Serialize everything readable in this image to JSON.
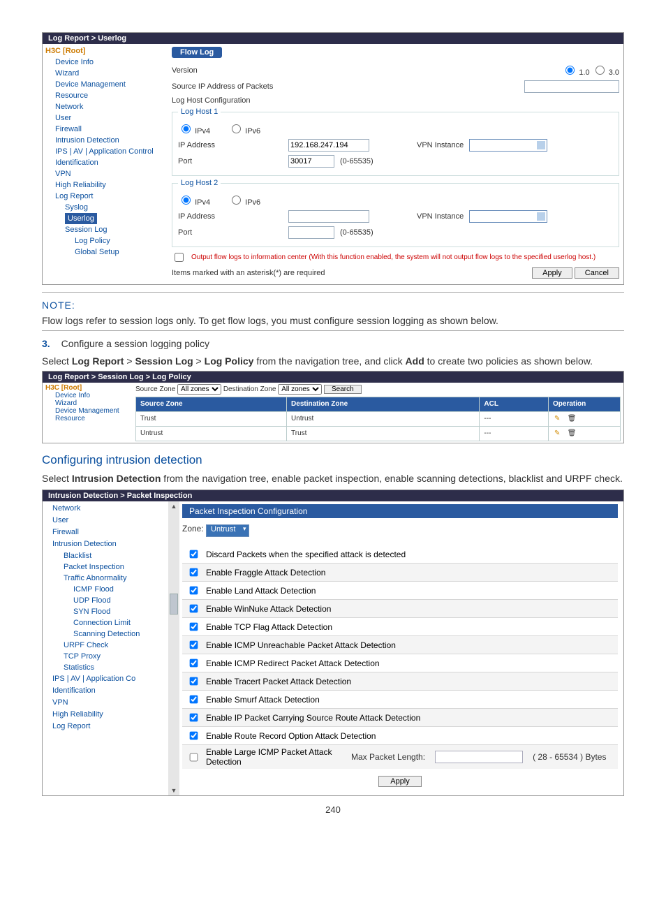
{
  "ss1": {
    "crumb": "Log Report > Userlog",
    "nav": {
      "root": "H3C [Root]",
      "items": [
        "Device Info",
        "Wizard",
        "Device Management",
        "Resource",
        "Network",
        "User",
        "Firewall",
        "Intrusion Detection",
        "IPS | AV | Application Control",
        "Identification",
        "VPN",
        "High Reliability",
        "Log Report"
      ],
      "sub": [
        "Syslog",
        "Userlog",
        "Session Log"
      ],
      "sub2": [
        "Log Policy",
        "Global Setup"
      ]
    },
    "tab": "Flow Log",
    "version_label": "Version",
    "version_opts": [
      "1.0",
      "3.0"
    ],
    "src_ip_label": "Source IP Address of Packets",
    "cfg_label": "Log Host Configuration",
    "legend1": "Log Host 1",
    "legend2": "Log Host 2",
    "ipv4": "IPv4",
    "ipv6": "IPv6",
    "ip_label": "IP Address",
    "ip_value": "192.168.247.194",
    "vpn_label": "VPN Instance",
    "port_label": "Port",
    "port_value": "30017",
    "port_range": "(0-65535)",
    "output_chk": "Output flow logs to information center (With this function enabled, the system will not output flow logs to the specified userlog host.)",
    "asterisk_note": "Items marked with an asterisk(*) are required",
    "apply": "Apply",
    "cancel": "Cancel"
  },
  "note": {
    "heading": "NOTE:",
    "body": "Flow logs refer to session logs only. To get flow logs, you must configure session logging as shown below."
  },
  "step3": {
    "num": "3.",
    "title": "Configure a session logging policy",
    "body_a": "Select ",
    "b1": "Log Report",
    "gt": " > ",
    "b2": "Session Log",
    "b3": "Log Policy",
    "body_b": " from the navigation tree, and click ",
    "b4": "Add",
    "body_c": " to create two policies as shown below."
  },
  "ss2": {
    "crumb": "Log Report > Session Log > Log Policy",
    "nav": [
      "H3C [Root]",
      "Device Info",
      "Wizard",
      "Device Management",
      "Resource"
    ],
    "filter": {
      "srcz": "Source Zone",
      "all1": "All zones",
      "dstz": "Destination Zone",
      "all2": "All zones",
      "search": "Search"
    },
    "cols": [
      "Source Zone",
      "Destination Zone",
      "ACL",
      "Operation"
    ],
    "rows": [
      {
        "src": "Trust",
        "dst": "Untrust",
        "acl": "---"
      },
      {
        "src": "Untrust",
        "dst": "Trust",
        "acl": "---"
      }
    ]
  },
  "sec2": {
    "heading": "Configuring intrusion detection",
    "body_a": "Select ",
    "b1": "Intrusion Detection",
    "body_b": " from the navigation tree, enable packet inspection, enable scanning detections, blacklist and URPF check."
  },
  "ss3": {
    "crumb": "Intrusion Detection > Packet Inspection",
    "nav": [
      "Network",
      "User",
      "Firewall",
      "Intrusion Detection",
      "Blacklist",
      "Packet Inspection",
      "Traffic Abnormality",
      "ICMP Flood",
      "UDP Flood",
      "SYN Flood",
      "Connection Limit",
      "Scanning Detection",
      "URPF Check",
      "TCP Proxy",
      "Statistics",
      "IPS | AV | Application Co",
      "Identification",
      "VPN",
      "High Reliability",
      "Log Report"
    ],
    "panel_head": "Packet Inspection Configuration",
    "zone_label": "Zone:",
    "zone_value": "Untrust",
    "checks": [
      "Discard Packets when the specified attack is detected",
      "Enable Fraggle Attack Detection",
      "Enable Land Attack Detection",
      "Enable WinNuke Attack Detection",
      "Enable TCP Flag Attack Detection",
      "Enable ICMP Unreachable Packet Attack Detection",
      "Enable ICMP Redirect Packet Attack Detection",
      "Enable Tracert Packet Attack Detection",
      "Enable Smurf Attack Detection",
      "Enable IP Packet Carrying Source Route Attack Detection",
      "Enable Route Record Option Attack Detection"
    ],
    "large_icmp": "Enable Large ICMP Packet Attack Detection",
    "mpl_label": "Max Packet Length:",
    "mpl_range": "( 28 - 65534 ) Bytes",
    "apply": "Apply"
  },
  "page_number": "240"
}
